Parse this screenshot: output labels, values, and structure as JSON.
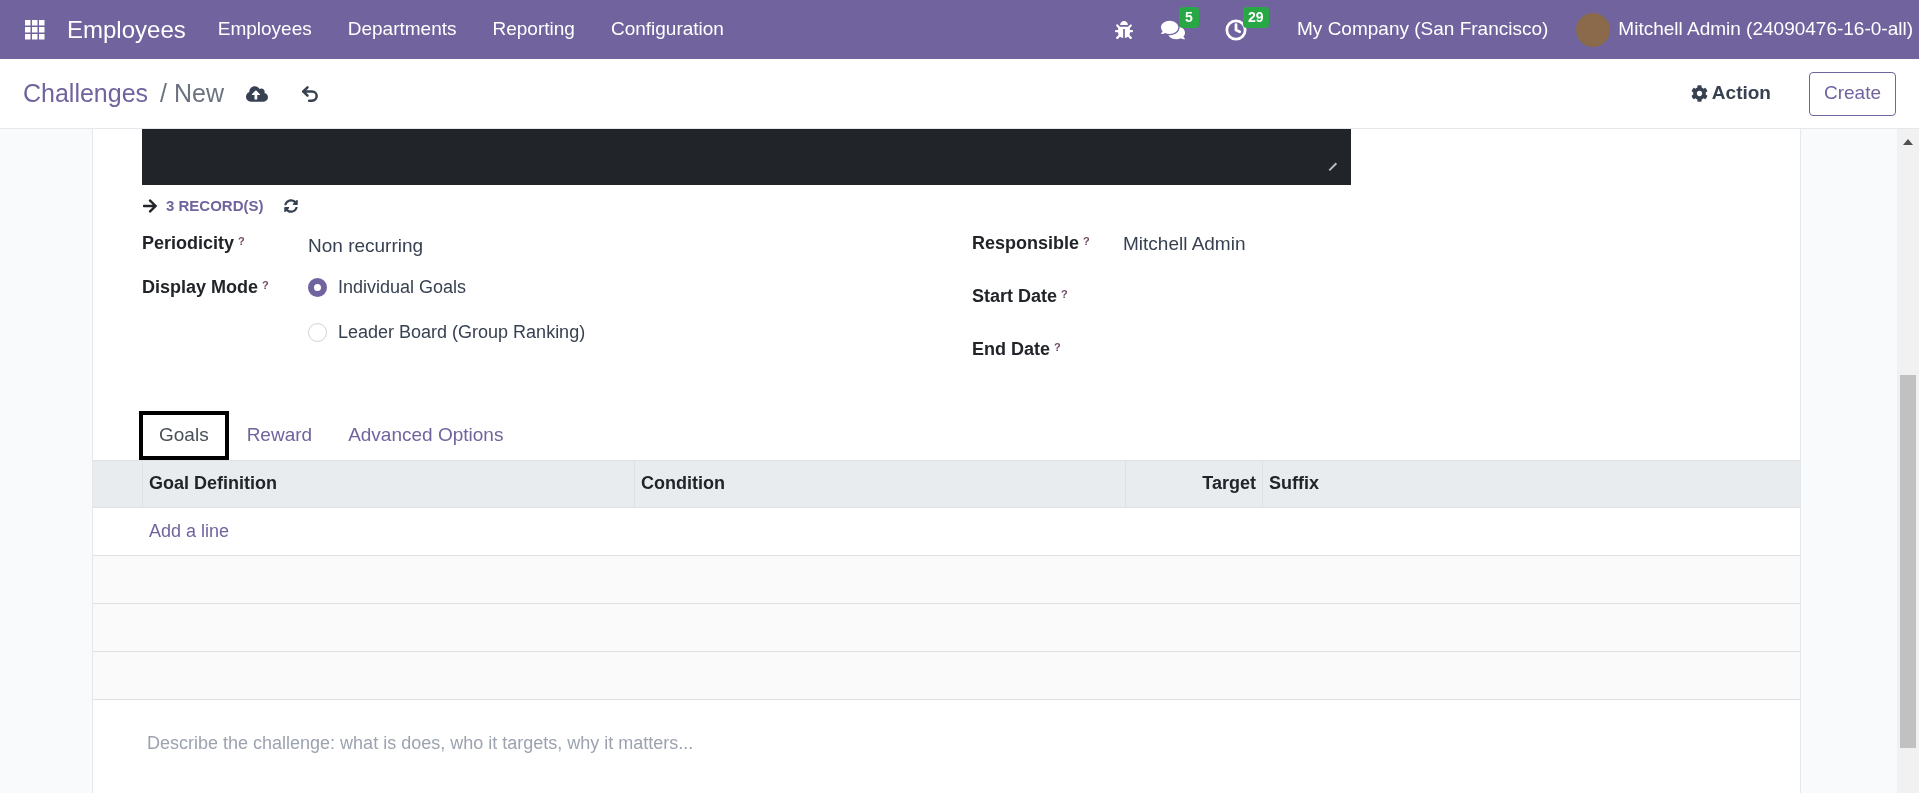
{
  "navbar": {
    "app_name": "Employees",
    "menu": [
      "Employees",
      "Departments",
      "Reporting",
      "Configuration"
    ],
    "messages_count": "5",
    "activities_count": "29",
    "company": "My Company (San Francisco)",
    "user": "Mitchell Admin (24090476-16-0-all)"
  },
  "breadcrumb": {
    "parent": "Challenges",
    "separator": "/",
    "current": "New"
  },
  "action_button": "Action",
  "create_button": "Create",
  "records_link": "3 RECORD(S)",
  "left_fields": [
    {
      "label": "Periodicity",
      "help": "?",
      "kind": "text",
      "value": "Non recurring"
    },
    {
      "label": "Display Mode",
      "help": "?",
      "kind": "radio",
      "options": [
        {
          "label": "Individual Goals",
          "selected": true
        },
        {
          "label": "Leader Board (Group Ranking)",
          "selected": false
        }
      ]
    }
  ],
  "right_fields": [
    {
      "label": "Responsible",
      "help": "?",
      "value": "Mitchell Admin"
    },
    {
      "label": "Start Date",
      "help": "?"
    },
    {
      "label": "End Date",
      "help": "?"
    }
  ],
  "tabs": [
    {
      "label": "Goals",
      "selected": true
    },
    {
      "label": "Reward",
      "selected": false
    },
    {
      "label": "Advanced Options",
      "selected": false
    }
  ],
  "table": {
    "columns": [
      {
        "label": "Goal Definition",
        "kind": "text"
      },
      {
        "label": "Condition",
        "kind": "text"
      },
      {
        "label": "Target",
        "kind": "number"
      },
      {
        "label": "Suffix",
        "kind": "text"
      }
    ],
    "add_line": "Add a line"
  },
  "description": {
    "placeholder": "Describe the challenge: what is does, who it targets, why it matters..."
  }
}
